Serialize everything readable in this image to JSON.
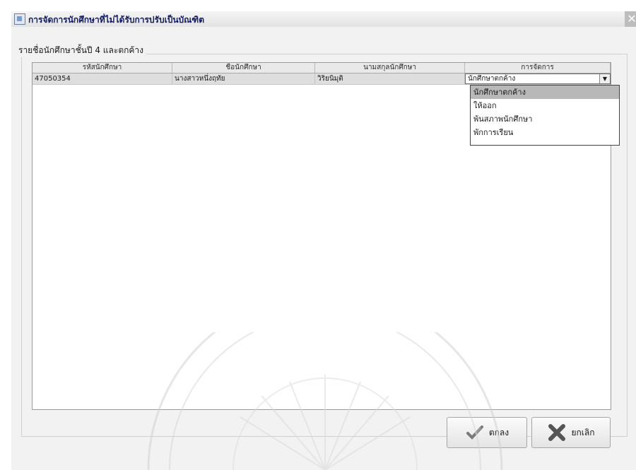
{
  "window": {
    "title": "การจัดการนักศึกษาที่ไม่ได้รับการปรับเป็นบัณฑิต",
    "close_symbol": "✕"
  },
  "group": {
    "label": "รายชื่อนักศึกษาชั้นปี 4 และตกค้าง"
  },
  "table": {
    "columns": [
      "รหัสนักศึกษา",
      "ชื่อนักศึกษา",
      "นามสกุลนักศึกษา",
      "การจัดการ"
    ],
    "rows": [
      {
        "student_id": "47050354",
        "first_name": "นางสาวหนึ่งฤทัย",
        "last_name": "วิริยนิมุติ",
        "action": "นักศึกษาตกค้าง"
      }
    ]
  },
  "action_dropdown": {
    "selected": "นักศึกษาตกค้าง",
    "options": [
      "นักศึกษาตกค้าง",
      "ให้ออก",
      "พ้นสภาพนักศึกษา",
      "พักการเรียน"
    ]
  },
  "buttons": {
    "ok": "ตกลง",
    "cancel": "ยกเลิก"
  },
  "icons": {
    "app": "window-icon",
    "ok": "checkmark-pen-icon",
    "cancel": "x-mark-icon"
  }
}
